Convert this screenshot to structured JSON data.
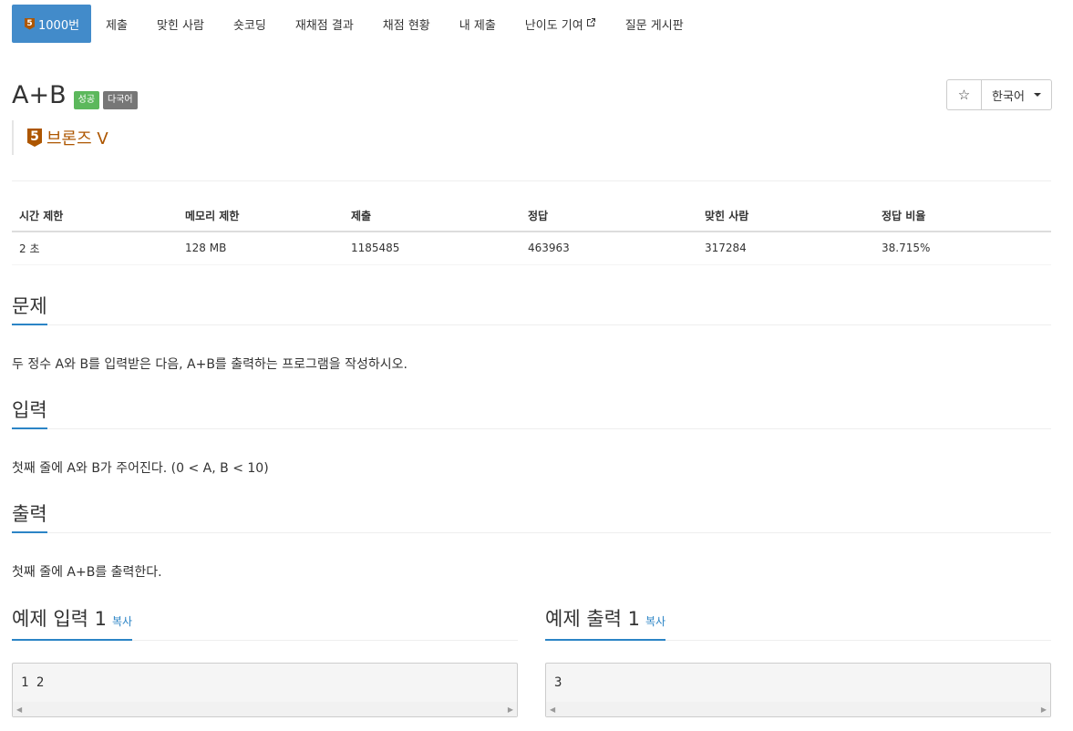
{
  "nav": {
    "active_tier_num": "5",
    "tabs": [
      {
        "label": "1000번"
      },
      {
        "label": "제출"
      },
      {
        "label": "맞힌 사람"
      },
      {
        "label": "숏코딩"
      },
      {
        "label": "재채점 결과"
      },
      {
        "label": "채점 현황"
      },
      {
        "label": "내 제출"
      },
      {
        "label": "난이도 기여"
      },
      {
        "label": "질문 게시판"
      }
    ]
  },
  "problem": {
    "title": "A+B",
    "label_success": "성공",
    "label_multilang": "다국어",
    "tier_num": "5",
    "tier_name": "브론즈 V"
  },
  "controls": {
    "star": "☆",
    "language": "한국어"
  },
  "info": {
    "headers": [
      "시간 제한",
      "메모리 제한",
      "제출",
      "정답",
      "맞힌 사람",
      "정답 비율"
    ],
    "values": [
      "2 초",
      "128 MB",
      "1185485",
      "463963",
      "317284",
      "38.715%"
    ]
  },
  "sections": {
    "problem_title": "문제",
    "problem_text": "두 정수 A와 B를 입력받은 다음, A+B를 출력하는 프로그램을 작성하시오.",
    "input_title": "입력",
    "input_text": "첫째 줄에 A와 B가 주어진다. (0 < A, B < 10)",
    "output_title": "출력",
    "output_text": "첫째 줄에 A+B를 출력한다."
  },
  "samples": {
    "input_title": "예제 입력 1",
    "output_title": "예제 출력 1",
    "copy_label": "복사",
    "input_value": "1 2",
    "output_value": "3"
  },
  "colors": {
    "nav_active": "#428bca",
    "bronze": "#ad5600",
    "success": "#5cb85c",
    "multilang": "#777777",
    "accent": "#2b84c6"
  }
}
